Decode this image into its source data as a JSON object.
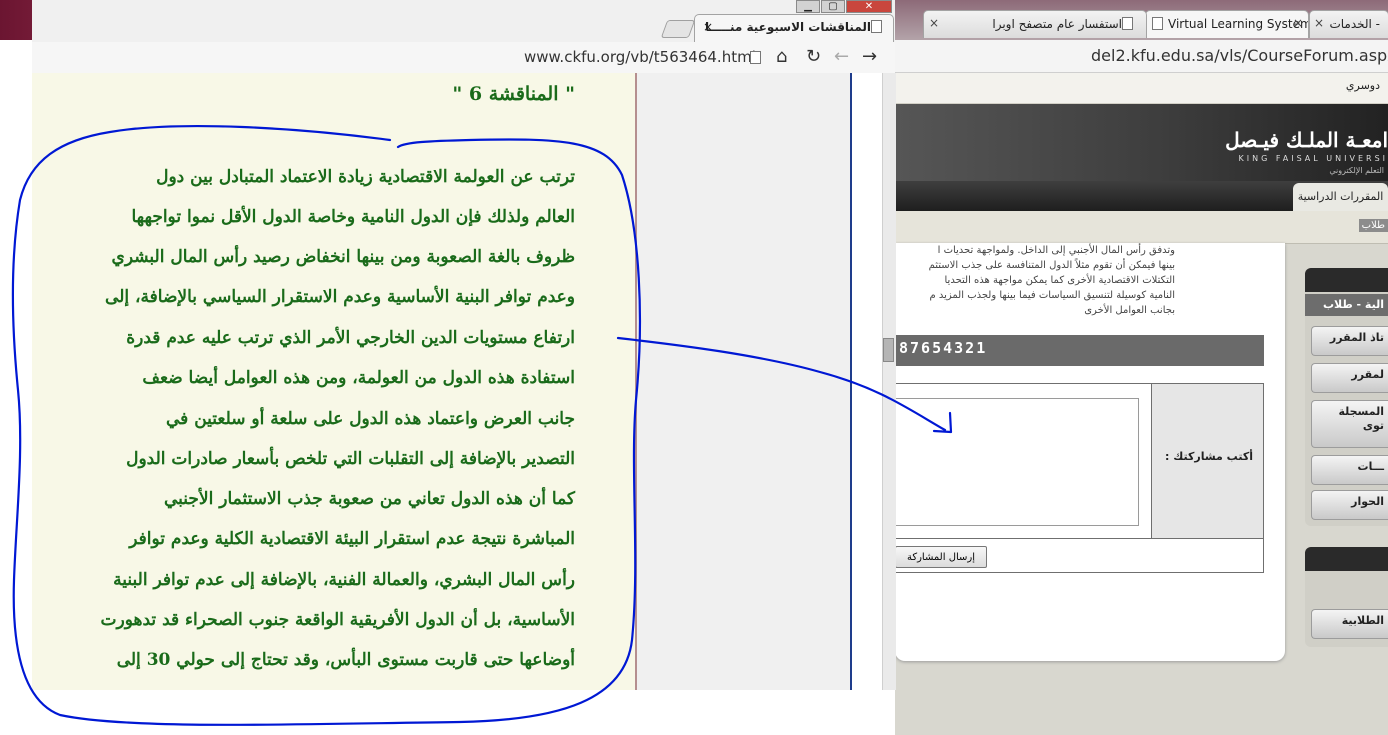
{
  "right_browser": {
    "tabs": [
      {
        "title": "Virtual Learning System",
        "close": "×"
      },
      {
        "title": "استفسار عام متصفح اوبرا",
        "close": "×"
      },
      {
        "title": "- الخدمات",
        "close": "×"
      }
    ],
    "url": "del2.kfu.edu.sa/vls/CourseForum.aspx"
  },
  "kfu": {
    "user_name": "دوسري",
    "logo_ar": "امعـة الملـك فيـصل",
    "logo_en": "KING FAISAL UNIVERSI",
    "logo_sub": "التعلم الإلكتروني",
    "nav_courses": "المقررات الدراسية",
    "sub_students": "طلاب",
    "post_lines": [
      "وتدفق رأس المال الأجنبي إلى الداخل. ولمواجهة تحديات ا",
      "بينها فيمكن أن تقوم مثلاً الدول المتنافسة على جذب الاستثم",
      "التكتلات الاقتصادية الأخرى كما يمكن مواجهة هذه التحديا",
      "النامية كوسيلة لتنسيق السياسات فيما بينها ولجذب المزيد م",
      "بجانب العوامل الأخرى"
    ],
    "bar_text": "87654321",
    "form_label": "أكتب مشاركتك :",
    "send_button": "إرسال المشاركة",
    "side1_title": "الية - طلاب",
    "side1_buttons": [
      "تاذ المقرر",
      "لمقرر",
      "المسجلة",
      "توى",
      "ـــات",
      "الحوار"
    ],
    "side2_buttons": [
      "الطلابية"
    ]
  },
  "left_browser": {
    "window_buttons": [
      "▁",
      "▢",
      "✕"
    ],
    "tab_title": "المناقشات الاسبوعية منـــــا",
    "tab_close": "×",
    "url": "www.ckfu.org/vb/t563464.html",
    "post_title": "\" المناقشة 6 \"",
    "post_lines": [
      "ترتب عن العولمة الاقتصادية زيادة الاعتماد المتبادل بين دول",
      "العالم ولذلك فإن الدول النامية وخاصة الدول الأقل نموا تواجهها",
      "ظروف بالغة الصعوبة ومن بينها انخفاض رصيد رأس المال البشري",
      "وعدم توافر البنية الأساسية وعدم الاستقرار السياسي بالإضافة، إلى",
      "ارتفاع مستويات الدين الخارجي الأمر الذي ترتب عليه عدم قدرة",
      "استفادة هذه الدول من العولمة، ومن هذه العوامل أيضا ضعف",
      "جانب العرض واعتماد هذه الدول على سلعة أو سلعتين في",
      "التصدير بالإضافة إلى التقلبات التي تلخص بأسعار صادرات الدول",
      "كما أن هذه الدول تعاني من صعوبة جذب الاستثمار الأجنبي",
      "المباشرة نتيجة عدم استقرار البيئة الاقتصادية الكلية وعدم توافر",
      "رأس المال البشري، والعمالة الفنية، بالإضافة إلى عدم توافر البنية",
      "الأساسية، بل أن الدول الأفريقية الواقعة جنوب الصحراء قد تدهورت",
      "أوضاعها حتى قاربت مستوى البأس، وقد تحتاج إلى حولي 30 إلى"
    ]
  }
}
